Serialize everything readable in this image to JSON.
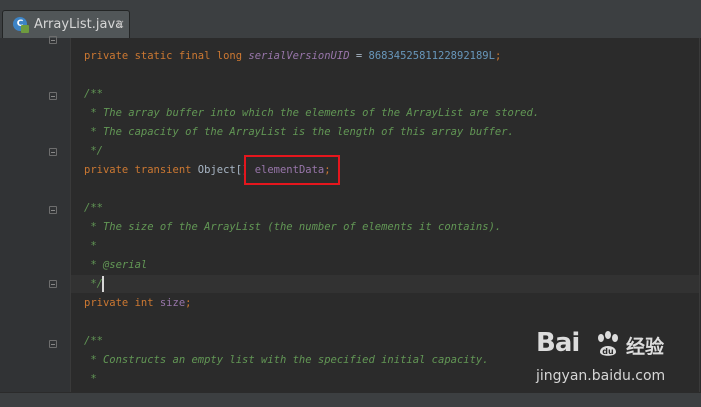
{
  "tab": {
    "title": "ArrayList.java",
    "close_glyph": "×",
    "icon": "java-class-icon",
    "icon_letter": "C"
  },
  "code": {
    "line_serial": {
      "prefix": "private static final long ",
      "field": "serialVersionUID",
      "eq": " = ",
      "value": "8683452581122892189L",
      "end": ";"
    },
    "c1_open": "/**",
    "c1_line1": " * The array buffer into which the elements of the ArrayList are stored.",
    "c1_line2": " * The capacity of the ArrayList is the length of this array buffer.",
    "c1_close": " */",
    "line_data": {
      "kw": "private transient ",
      "type": "Object[] ",
      "field": "elementData",
      "end": ";"
    },
    "c2_open": "/**",
    "c2_line1": " * The size of the ArrayList (the number of elements it contains).",
    "c2_line2": " *",
    "c2_line3_prefix": " * ",
    "c2_line3_tag": "@serial",
    "c2_close": " */",
    "line_size": {
      "kw": "private int ",
      "field": "size",
      "end": ";"
    },
    "c3_open": "/**",
    "c3_line1": " * Constructs an empty list with the specified initial capacity.",
    "c3_line2": " *"
  },
  "watermark": {
    "logo_left": "Bai",
    "logo_right": "du",
    "cn": "经验",
    "url": "jingyan.baidu.com"
  },
  "colors": {
    "highlight": "#e5161d",
    "keyword": "#cc7832",
    "comment": "#629755",
    "field": "#9876aa",
    "number": "#6897bb"
  }
}
